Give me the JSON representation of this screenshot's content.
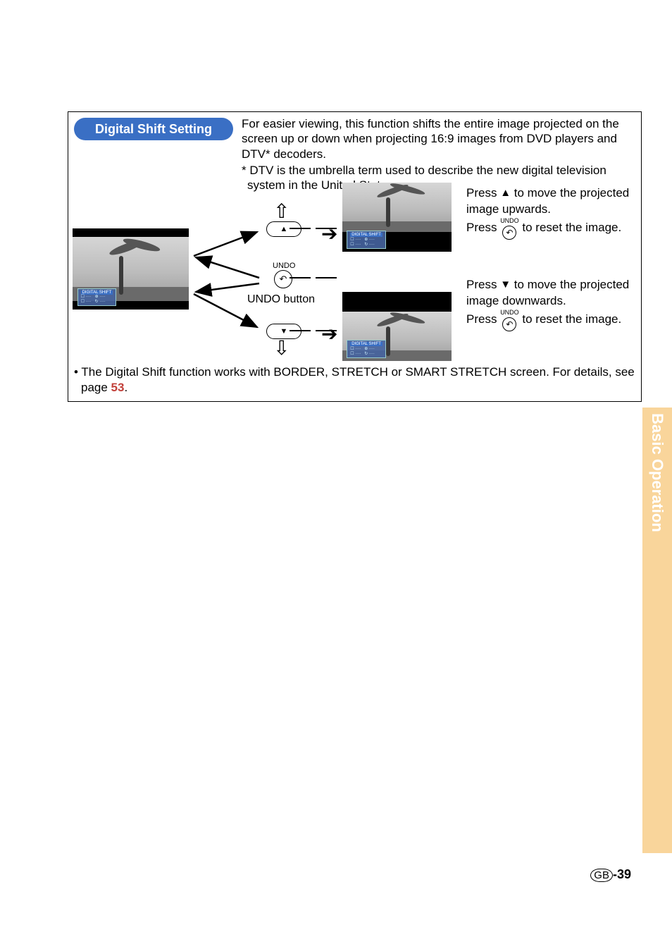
{
  "side_tab": "Basic Operation",
  "footer": {
    "region": "GB",
    "page": "-39"
  },
  "pill": "Digital Shift Setting",
  "intro": {
    "main": "For easier viewing, this function shifts the entire image projected on the screen up or down when projecting 16:9 images from DVD players and DTV* decoders.",
    "star": "* DTV is the umbrella term used to describe the new digital television system in the United States."
  },
  "diagram": {
    "undo_small_label": "UNDO",
    "undo_caption": "UNDO button",
    "osd_title": "DIGITAL SHIFT"
  },
  "right_top": {
    "l1a": "Press ",
    "l1b": " to move the projected image upwards.",
    "l2a": "Press ",
    "l2b": " to reset the image.",
    "undo_label": "UNDO"
  },
  "right_bot": {
    "l1a": "Press ",
    "l1b": " to move the projected image downwards.",
    "l2a": "Press ",
    "l2b": " to reset the image.",
    "undo_label": "UNDO"
  },
  "note": {
    "bullet": "•",
    "t1": " The Digital Shift function works with BORDER, STRETCH or SMART STRETCH screen. For details, see page ",
    "pg": "53",
    "t2": "."
  }
}
